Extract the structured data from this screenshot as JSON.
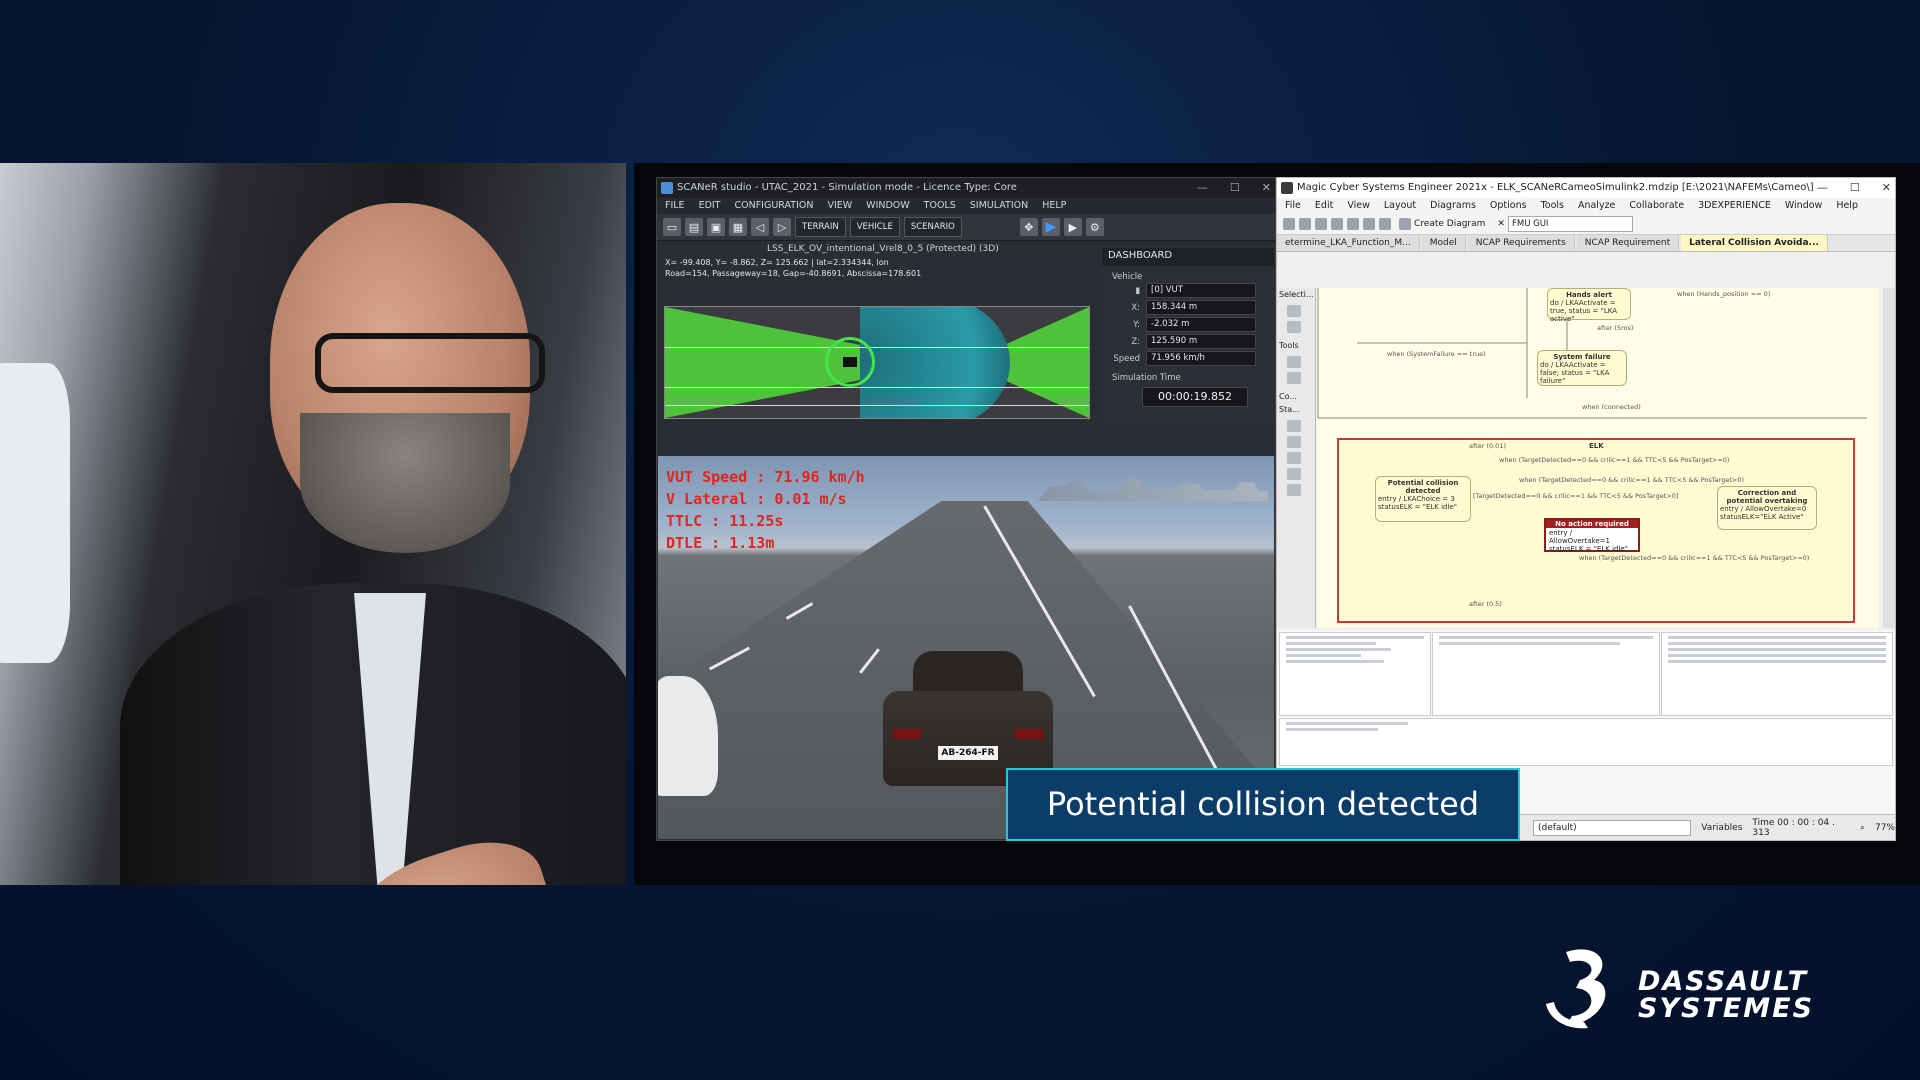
{
  "caption": "Potential collision detected",
  "brand": {
    "line1": "DASSAULT",
    "line2": "SYSTEMES"
  },
  "scaner": {
    "title": "SCANeR studio - UTAC_2021 - Simulation mode - Licence Type: Core",
    "menu": [
      "FILE",
      "EDIT",
      "CONFIGURATION",
      "VIEW",
      "WINDOW",
      "TOOLS",
      "SIMULATION",
      "HELP"
    ],
    "toolbar_buttons": [
      "TERRAIN",
      "VEHICLE",
      "SCENARIO"
    ],
    "view_title": "LSS_ELK_OV_intentional_Vrel8_0_5 (Protected) (3D)",
    "coords_line1": "X= -99.408, Y= -8.862, Z= 125.662 | lat=2.334344, lon",
    "coords_line2": "Road=154, Passageway=18, Gap=-40.8691, Abscissa=178.601",
    "hud": {
      "vut_speed": "VUT Speed : 71.96 km/h",
      "v_lateral": "V Lateral : 0.01 m/s",
      "ttlc": "TTLC : 11.25s",
      "dtle": "DTLE : 1.13m"
    },
    "plate": "AB-264-FR",
    "dashboard": {
      "title": "DASHBOARD",
      "group": "Vehicle",
      "vehicle": "[0] VUT",
      "x_label": "X:",
      "x": "158.344 m",
      "y_label": "Y:",
      "y": "-2.032 m",
      "z_label": "Z:",
      "z": "125.590 m",
      "speed_label": "Speed",
      "speed": "71.956 km/h",
      "sim_time_label": "Simulation Time",
      "sim_time": "00:00:19.852"
    }
  },
  "cameo": {
    "title": "Magic Cyber Systems Engineer 2021x - ELK_SCANeRCameoSimulink2.mdzip [E:\\2021\\NAFEMs\\Cameo\\]",
    "menu": [
      "File",
      "Edit",
      "View",
      "Layout",
      "Diagrams",
      "Options",
      "Tools",
      "Analyze",
      "Collaborate",
      "3DEXPERIENCE",
      "Window",
      "Help"
    ],
    "create_diagram": "Create Diagram",
    "fmu_combo": "FMU GUI",
    "tabs": [
      "etermine_LKA_Function_M...",
      "Model",
      "NCAP Requirements",
      "NCAP Requirement",
      "Lateral Collision Avoida..."
    ],
    "palette_labels": [
      "Selecti...",
      "Tools",
      "Co...",
      "Sta..."
    ],
    "diagram": {
      "hands_alert": "Hands alert",
      "hands_alert_body": "do / LKAActivate = true, status = \"LKA active\"",
      "when_hands": "when (Hands_position == 0)",
      "after_5ms": "after (5ms)",
      "when_system_failure": "when (SystemFailure == true)",
      "system_failure": "System failure",
      "system_failure_body": "do / LKAActivate = false; status = \"LKA failure\"",
      "when_connected": "when (connected)",
      "elk": "ELK",
      "after_001": "after (0.01)",
      "cond1": "when (TargetDetected==0 && crilic==1 && TTC<5 && PosTarget>=0)",
      "cond2": "when (TargetDetected==0 && crilic==1 && TTC<5 && PosTarget>0)",
      "cond3": "[TargetDetected==0 && crilic==1 && TTC<5 && PosTarget>0]",
      "potential_collision": "Potential collision detected",
      "potential_body": "entry / LKAChoice = 3 statusELK = \"ELK idle\"",
      "no_action": "No action required",
      "no_action_body": "entry / AllowOvertake=1 statusELK = \"ELK idle\"",
      "correction": "Correction and potential overtaking",
      "correction_body": "entry / AllowOvertake=0 statusELK=\"ELK Active\"",
      "cond4": "when (TargetDetected==0 && crilic==1 && TTC<5 && PosTarget>=0)",
      "after_05": "after (0.5)"
    },
    "status": {
      "combo": "(default)",
      "time": "Time 00 : 00 : 04 . 313",
      "zoom": "77%",
      "variables": "Variables"
    }
  }
}
